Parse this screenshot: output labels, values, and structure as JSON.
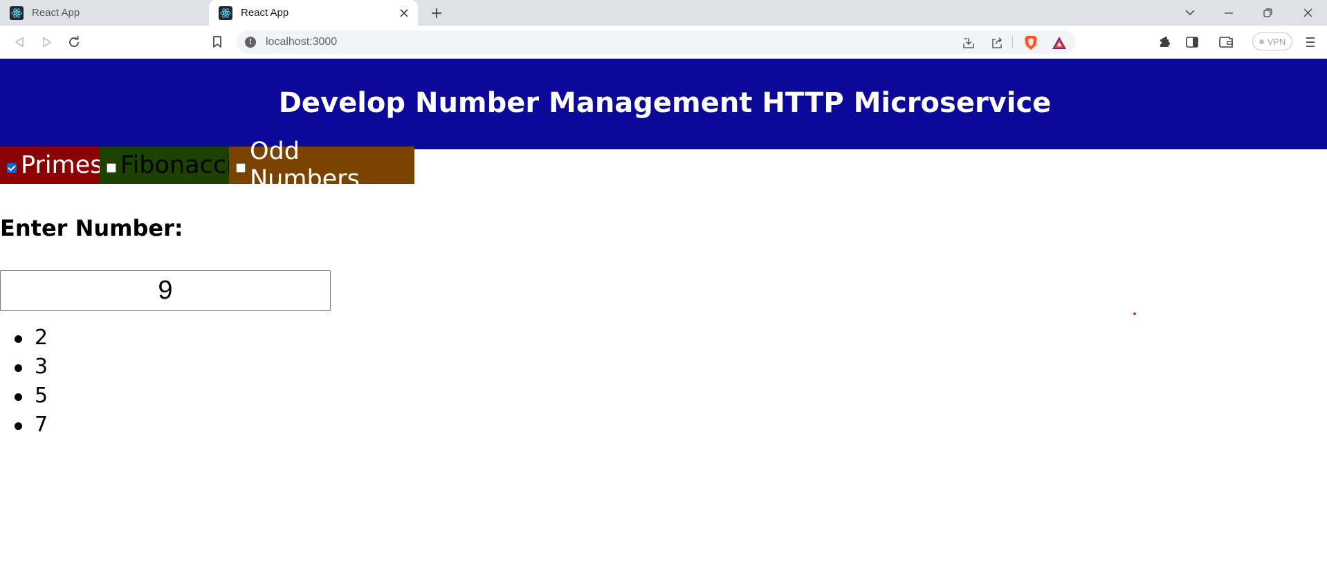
{
  "browser": {
    "tabs": [
      {
        "title": "React App",
        "active": false
      },
      {
        "title": "React App",
        "active": true
      }
    ],
    "url": "localhost:3000",
    "vpn_label": "VPN",
    "favicon_icon": "react-logo-icon"
  },
  "app": {
    "title": "Develop Number Management HTTP Microservice",
    "filters": [
      {
        "label": "Primes",
        "checked": true,
        "color": "#8b0000"
      },
      {
        "label": "Fibonacci",
        "checked": false,
        "color": "#1c4100"
      },
      {
        "label": "Odd Numbers",
        "checked": false,
        "color": "#7a4300"
      }
    ],
    "input_label": "Enter Number:",
    "input_value": "9",
    "results": [
      "2",
      "3",
      "5",
      "7"
    ],
    "header_color": "#0b089a"
  }
}
